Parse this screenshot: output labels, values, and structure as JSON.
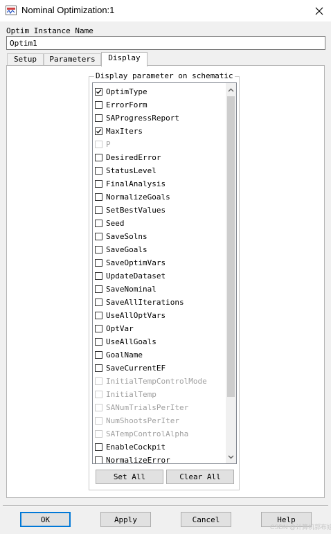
{
  "window": {
    "title": "Nominal Optimization:1",
    "icon": "ads-schematic-icon"
  },
  "instance": {
    "label": "Optim Instance Name",
    "value": "Optim1"
  },
  "tabs": [
    {
      "label": "Setup",
      "active": false
    },
    {
      "label": "Parameters",
      "active": false
    },
    {
      "label": "Display",
      "active": true
    }
  ],
  "display_group": {
    "legend": "Display parameter on schematic",
    "items": [
      {
        "label": "OptimType",
        "checked": true,
        "enabled": true
      },
      {
        "label": "ErrorForm",
        "checked": false,
        "enabled": true
      },
      {
        "label": "SAProgressReport",
        "checked": false,
        "enabled": true
      },
      {
        "label": "MaxIters",
        "checked": true,
        "enabled": true
      },
      {
        "label": "P",
        "checked": false,
        "enabled": false
      },
      {
        "label": "DesiredError",
        "checked": false,
        "enabled": true
      },
      {
        "label": "StatusLevel",
        "checked": false,
        "enabled": true
      },
      {
        "label": "FinalAnalysis",
        "checked": false,
        "enabled": true
      },
      {
        "label": "NormalizeGoals",
        "checked": false,
        "enabled": true
      },
      {
        "label": "SetBestValues",
        "checked": false,
        "enabled": true
      },
      {
        "label": "Seed",
        "checked": false,
        "enabled": true
      },
      {
        "label": "SaveSolns",
        "checked": false,
        "enabled": true
      },
      {
        "label": "SaveGoals",
        "checked": false,
        "enabled": true
      },
      {
        "label": "SaveOptimVars",
        "checked": false,
        "enabled": true
      },
      {
        "label": "UpdateDataset",
        "checked": false,
        "enabled": true
      },
      {
        "label": "SaveNominal",
        "checked": false,
        "enabled": true
      },
      {
        "label": "SaveAllIterations",
        "checked": false,
        "enabled": true
      },
      {
        "label": "UseAllOptVars",
        "checked": false,
        "enabled": true
      },
      {
        "label": "OptVar",
        "checked": false,
        "enabled": true
      },
      {
        "label": "UseAllGoals",
        "checked": false,
        "enabled": true
      },
      {
        "label": "GoalName",
        "checked": false,
        "enabled": true
      },
      {
        "label": "SaveCurrentEF",
        "checked": false,
        "enabled": true
      },
      {
        "label": "InitialTempControlMode",
        "checked": false,
        "enabled": false
      },
      {
        "label": "InitialTemp",
        "checked": false,
        "enabled": false
      },
      {
        "label": "SANumTrialsPerIter",
        "checked": false,
        "enabled": false
      },
      {
        "label": "NumShootsPerIter",
        "checked": false,
        "enabled": false
      },
      {
        "label": "SATempControlAlpha",
        "checked": false,
        "enabled": false
      },
      {
        "label": "EnableCockpit",
        "checked": false,
        "enabled": true
      },
      {
        "label": "NormalizeError",
        "checked": false,
        "enabled": true
      }
    ],
    "set_all": "Set All",
    "clear_all": "Clear All"
  },
  "footer": {
    "ok": "OK",
    "apply": "Apply",
    "cancel": "Cancel",
    "help": "Help"
  },
  "watermark": "CSDN @计算机郭布娃",
  "colors": {
    "focus": "#0078d7",
    "disabled_text": "#a0a0a0"
  }
}
